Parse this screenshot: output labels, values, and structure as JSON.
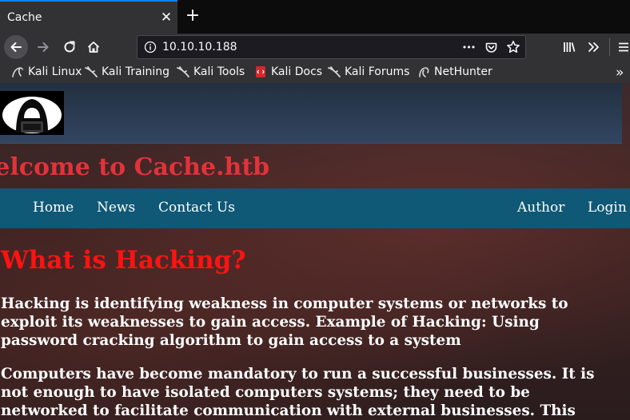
{
  "browser": {
    "tab_title": "Cache",
    "tab_close": "✕",
    "new_tab": "+",
    "url": "10.10.10.188",
    "url_more": "•••",
    "bookmarks": [
      {
        "label": "Kali Linux",
        "icon": "kali-dragon-icon"
      },
      {
        "label": "Kali Training",
        "icon": "kali-dragon-icon"
      },
      {
        "label": "Kali Tools",
        "icon": "kali-dragon-icon"
      },
      {
        "label": "Kali Docs",
        "icon": "kali-docs-icon"
      },
      {
        "label": "Kali Forums",
        "icon": "kali-dragon-icon"
      },
      {
        "label": "NetHunter",
        "icon": "nethunter-icon"
      }
    ],
    "bookmarks_overflow": "»",
    "colors": {
      "accent": "#0a84ff",
      "toolbar": "#323234",
      "tabbar": "#0c0c0d"
    }
  },
  "site": {
    "welcome": "Welcome to Cache.htb",
    "menu": {
      "home": "Home",
      "news": "News",
      "contact": "Contact Us",
      "author": "Author",
      "login": "Login"
    },
    "headline": "What is Hacking?",
    "paragraph1": [
      "Hacking is identifying weakness in computer systems or networks to",
      "exploit its weaknesses to gain access. Example of Hacking: Using",
      "password cracking algorithm to gain access to a system"
    ],
    "paragraph2": [
      "Computers have become mandatory to run a successful businesses. It is",
      "not enough to have isolated computers systems; they need to be",
      "networked to facilitate communication with external businesses. This"
    ],
    "colors": {
      "welcome": "#e2323a",
      "headline": "#ff1212",
      "menubar": "#0f5876"
    }
  }
}
